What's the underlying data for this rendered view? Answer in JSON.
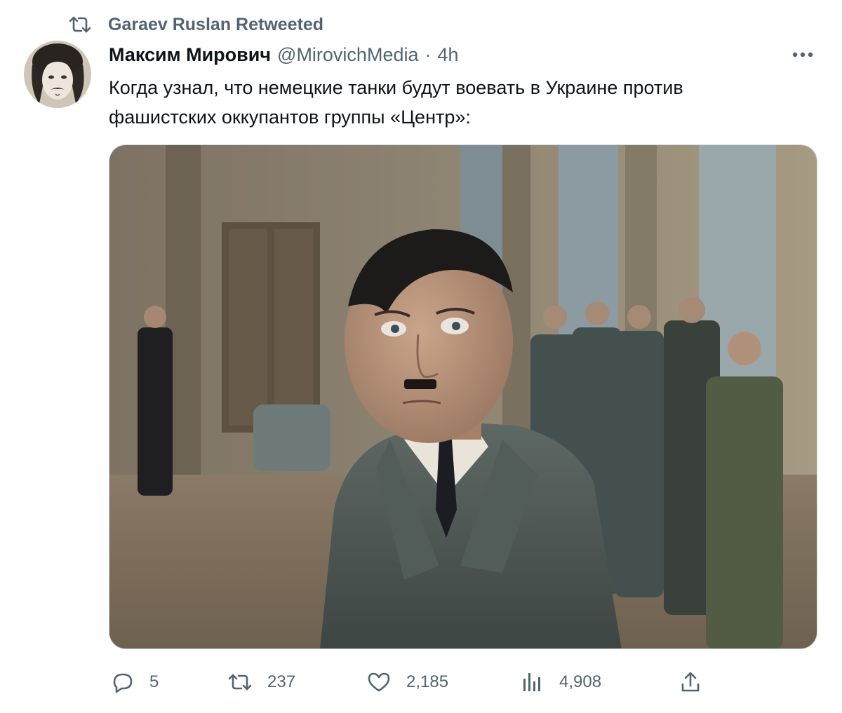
{
  "retweet_banner": {
    "label": "Garaev Ruslan Retweeted",
    "icon": "retweet-icon"
  },
  "tweet": {
    "author": {
      "display_name": "Максим Мирович",
      "handle": "@MirovichMedia",
      "avatar_icon": "avatar"
    },
    "separator": "·",
    "time": "4h",
    "text_line1": "Когда узнал, что немецкие танки будут воевать в Украине против",
    "text_line2": "фашистских оккупантов группы «Центр»:",
    "more_icon": "more-horizontal-icon"
  },
  "actions": {
    "replies": {
      "icon": "reply-icon",
      "count": "5"
    },
    "retweets": {
      "icon": "retweet-icon",
      "count": "237"
    },
    "likes": {
      "icon": "heart-icon",
      "count": "2,185"
    },
    "views": {
      "icon": "views-chart-icon",
      "count": "4,908"
    },
    "share": {
      "icon": "share-icon"
    }
  },
  "colors": {
    "text_primary": "#0f1419",
    "text_secondary": "#536471",
    "border": "#cfd9de"
  }
}
